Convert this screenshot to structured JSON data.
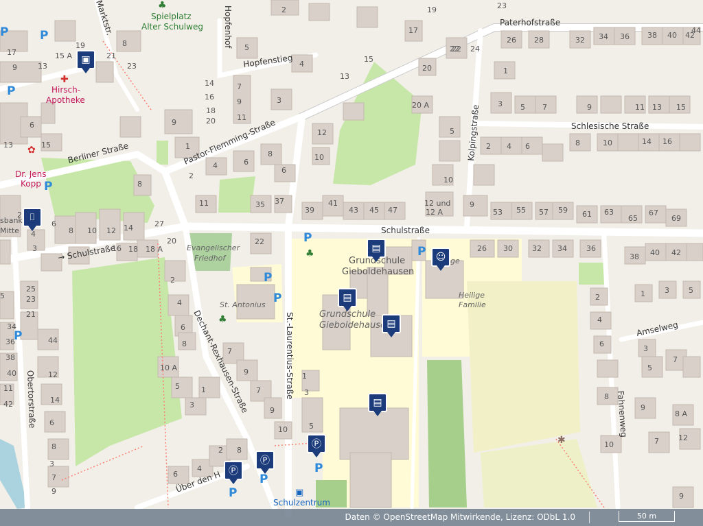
{
  "streets": {
    "paterhof": "Paterhofstraße",
    "hopfensteig": "Hopfenstieg",
    "hopfenhof": "Hopfenhof",
    "marktstr": "Marktstr.",
    "pastor": "Pastor-Flemming-Straße",
    "berliner": "Berliner Straße",
    "schulstr_east": "Schulstraße",
    "schulstr_west": "→ Schulstraße",
    "kolping": "Kolpingstraße",
    "schlesische": "Schlesische Straße",
    "laurentius": "St.-Laurentius-Straße",
    "dechant": "Dechant-Rexhausen-Straße",
    "obertor": "Obertorstraße",
    "amselweg": "Amselweg",
    "fahnenweg": "Fahnenweg",
    "ueber": "Über den H"
  },
  "pois": {
    "spielplatz_1": "Spielplatz",
    "spielplatz_2": "Alter Schulweg",
    "apotheke_1": "Hirsch-",
    "apotheke_2": "Apotheke",
    "kopp_1": "Dr. Jens",
    "kopp_2": "Kopp",
    "bank_1": "sbank",
    "bank_2": "Mitte",
    "friedhof_1": "Evangelischer",
    "friedhof_2": "Friedhof",
    "antonius": "St. Antonius",
    "grundschule_1": "Grundschule",
    "grundschule_2": "Gieboldehausen",
    "grundschule_it_1": "Grundschule",
    "grundschule_it_2": "Gieboldehausen",
    "heilige_1": "Heilige",
    "heilige_2": "Familie",
    "kirche_stub": "ge",
    "schulzentrum": "Schulzentrum"
  },
  "house_numbers": {
    "n1": "2",
    "n2": "17",
    "n3": "19",
    "n4": "23",
    "n5": "22",
    "n6": "5",
    "n7": "4",
    "n8": "13",
    "n9": "15",
    "n10": "14",
    "n11": "16",
    "n12": "18",
    "n13": "20",
    "n14": "7",
    "n15": "9",
    "n16": "11",
    "n17": "3",
    "n18": "9",
    "n19": "1",
    "n20": "6",
    "n21": "8",
    "n22": "2",
    "n23": "4",
    "n24": "6",
    "n25": "8",
    "n26": "10",
    "n27": "11",
    "n28": "35",
    "n29": "37",
    "n30": "39",
    "n31": "41",
    "n32": "43",
    "n33": "45",
    "n34": "47",
    "n35": "12",
    "n36": "10",
    "n37": "12 und",
    "n38": "12 A",
    "n39": "22",
    "n40": "24",
    "n41": "20",
    "n42": "20 A",
    "n43": "1",
    "n44": "3",
    "n45": "5",
    "n46": "7",
    "n47": "9",
    "n48": "11",
    "n49": "13",
    "n50": "15",
    "n51": "5",
    "n52": "2",
    "n53": "4",
    "n54": "6",
    "n55": "8",
    "n56": "10",
    "n57": "14",
    "n58": "16",
    "n59": "9",
    "n60": "53",
    "n61": "55",
    "n62": "57",
    "n63": "59",
    "n64": "61",
    "n65": "63",
    "n66": "65",
    "n67": "67",
    "n68": "69",
    "n69": "26",
    "n70": "30",
    "n71": "32",
    "n72": "34",
    "n73": "36",
    "n74": "38",
    "n75": "40",
    "n76": "42",
    "n77": "1",
    "n78": "3",
    "n79": "5",
    "n80": "2",
    "n81": "4",
    "n82": "6",
    "n83": "3",
    "n84": "5",
    "n85": "7",
    "n86": "8",
    "n87": "9",
    "n88": "8 A",
    "n89": "10",
    "n90": "12",
    "n91": "7",
    "n92": "9",
    "n93": "26",
    "n94": "28",
    "n95": "32",
    "n96": "34",
    "n97": "36",
    "n98": "38",
    "n99": "40",
    "n100": "42",
    "n101": "44",
    "n102": "15 A",
    "n103": "9",
    "n104": "13",
    "n105": "6",
    "n106": "8",
    "n107": "2",
    "n108": "4",
    "n109": "6",
    "n110": "8",
    "n111": "10",
    "n112": "12",
    "n113": "14",
    "n114": "16",
    "n115": "18",
    "n116": "18 A",
    "n117": "20",
    "n118": "22",
    "n119": "27",
    "n120": "3",
    "n121": "5",
    "n122": "25",
    "n123": "23",
    "n124": "21",
    "n125": "34",
    "n126": "36",
    "n127": "38",
    "n128": "40",
    "n129": "42",
    "n130": "44",
    "n131": "2",
    "n132": "4",
    "n133": "6",
    "n134": "8",
    "n135": "10 A",
    "n136": "1",
    "n137": "3",
    "n138": "5",
    "n139": "7",
    "n140": "9",
    "n141": "1",
    "n142": "3",
    "n143": "5",
    "n144": "7",
    "n145": "9",
    "n146": "2",
    "n147": "4",
    "n148": "6",
    "n149": "8",
    "n150": "10",
    "n151": "12",
    "n152": "14",
    "n153": "6",
    "n154": "8",
    "n155": "3",
    "n156": "7",
    "n157": "9",
    "n158": "11",
    "n159": "13",
    "n160": "15",
    "n161": "17",
    "n162": "19",
    "n163": "21",
    "n164": "23"
  },
  "markers": {
    "school_icon": "school-bag-icon",
    "parking_icon": "parking-icon",
    "playground_icon": "playground-icon",
    "shop_icon": "shopping-basket-icon",
    "pharmacy_icon": "pharmacy-icon",
    "parking_letter": "P"
  },
  "attribution": {
    "text": "Daten © OpenStreetMap Mitwirkende, Lizenz: ODbL 1.0",
    "scale": "50 m"
  },
  "colors": {
    "school_area": "#fffbd6",
    "green": "#c8e6a0",
    "marker": "#1b3b7a",
    "parking": "#2e8ad8"
  }
}
